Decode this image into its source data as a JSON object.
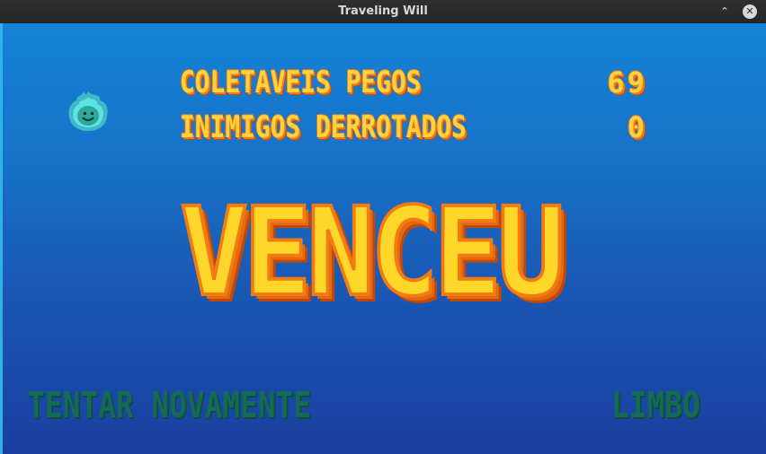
{
  "window": {
    "title": "Traveling Will",
    "minimize_glyph": "⌃",
    "close_glyph": "✕"
  },
  "stats": [
    {
      "label": "COLETAVEIS PEGOS",
      "value": "69"
    },
    {
      "label": "INIMIGOS DERROTADOS",
      "value": "0"
    }
  ],
  "result": "VENCEU",
  "menu": {
    "retry_label": "TENTAR NOVAMENTE",
    "limbo_label": "LIMBO"
  },
  "colors": {
    "background_top": "#1483d6",
    "background_bottom": "#1a3ea0",
    "text_yellow": "#ffd23f",
    "text_orange": "#f07a18",
    "menu_green": "#146a56",
    "character_cyan": "#5fe3e0"
  },
  "icons": {
    "character": "smiling-flame-sprite"
  }
}
